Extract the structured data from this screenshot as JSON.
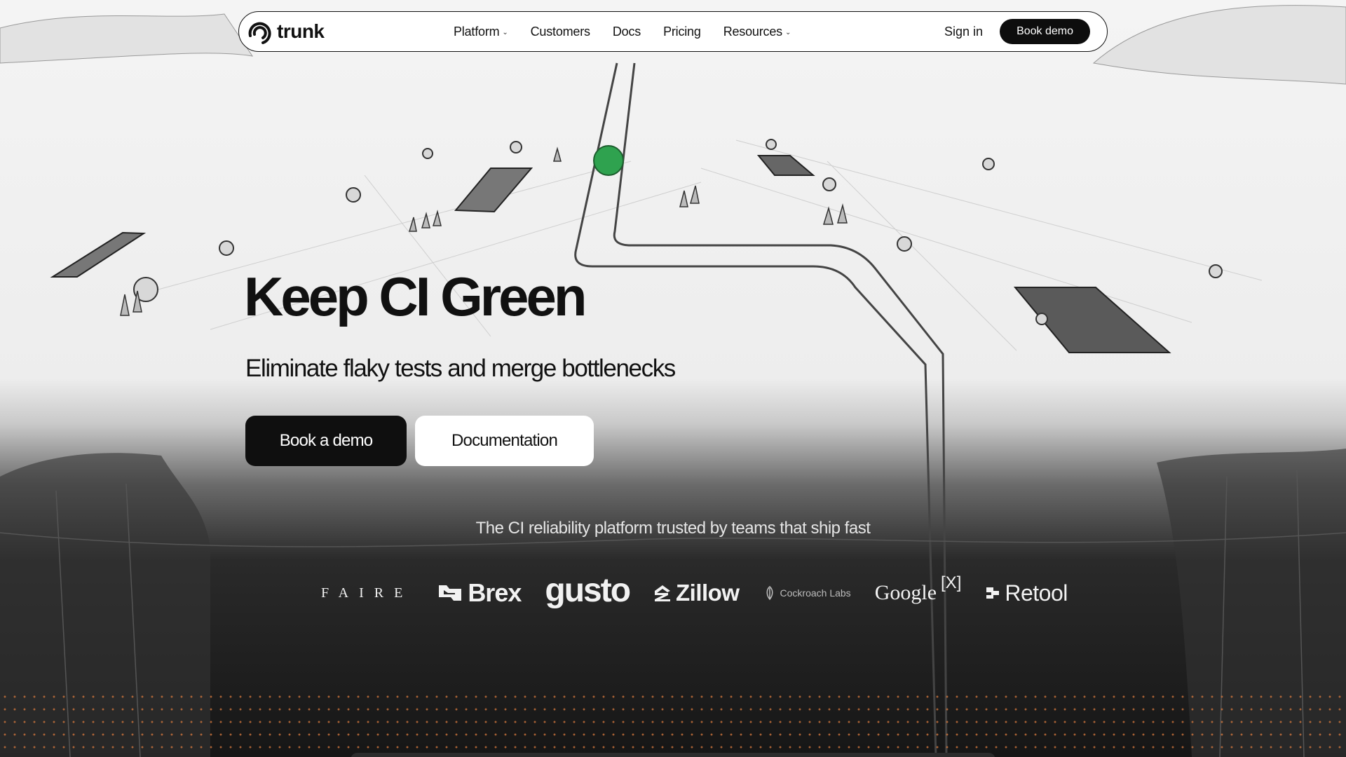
{
  "nav": {
    "logo_text": "trunk",
    "links": [
      {
        "label": "Platform",
        "dropdown": true
      },
      {
        "label": "Customers",
        "dropdown": false
      },
      {
        "label": "Docs",
        "dropdown": false
      },
      {
        "label": "Pricing",
        "dropdown": false
      },
      {
        "label": "Resources",
        "dropdown": true
      }
    ],
    "sign_in": "Sign in",
    "cta": "Book demo"
  },
  "hero": {
    "title": "Keep CI Green",
    "subtitle": "Eliminate flaky tests and merge bottlenecks",
    "primary_button": "Book a demo",
    "secondary_button": "Documentation"
  },
  "trusted": {
    "text": "The CI reliability platform trusted by teams that ship fast",
    "logos": {
      "faire": "FAIRE",
      "brex": "Brex",
      "gusto": "gusto",
      "zillow": "Zillow",
      "cockroach": "Cockroach Labs",
      "google": "Google",
      "google_x": "[X]",
      "retool": "Retool"
    }
  },
  "colors": {
    "accent_green": "#2fa24f",
    "dark": "#0f0f0f",
    "dots": "#d6783c"
  }
}
